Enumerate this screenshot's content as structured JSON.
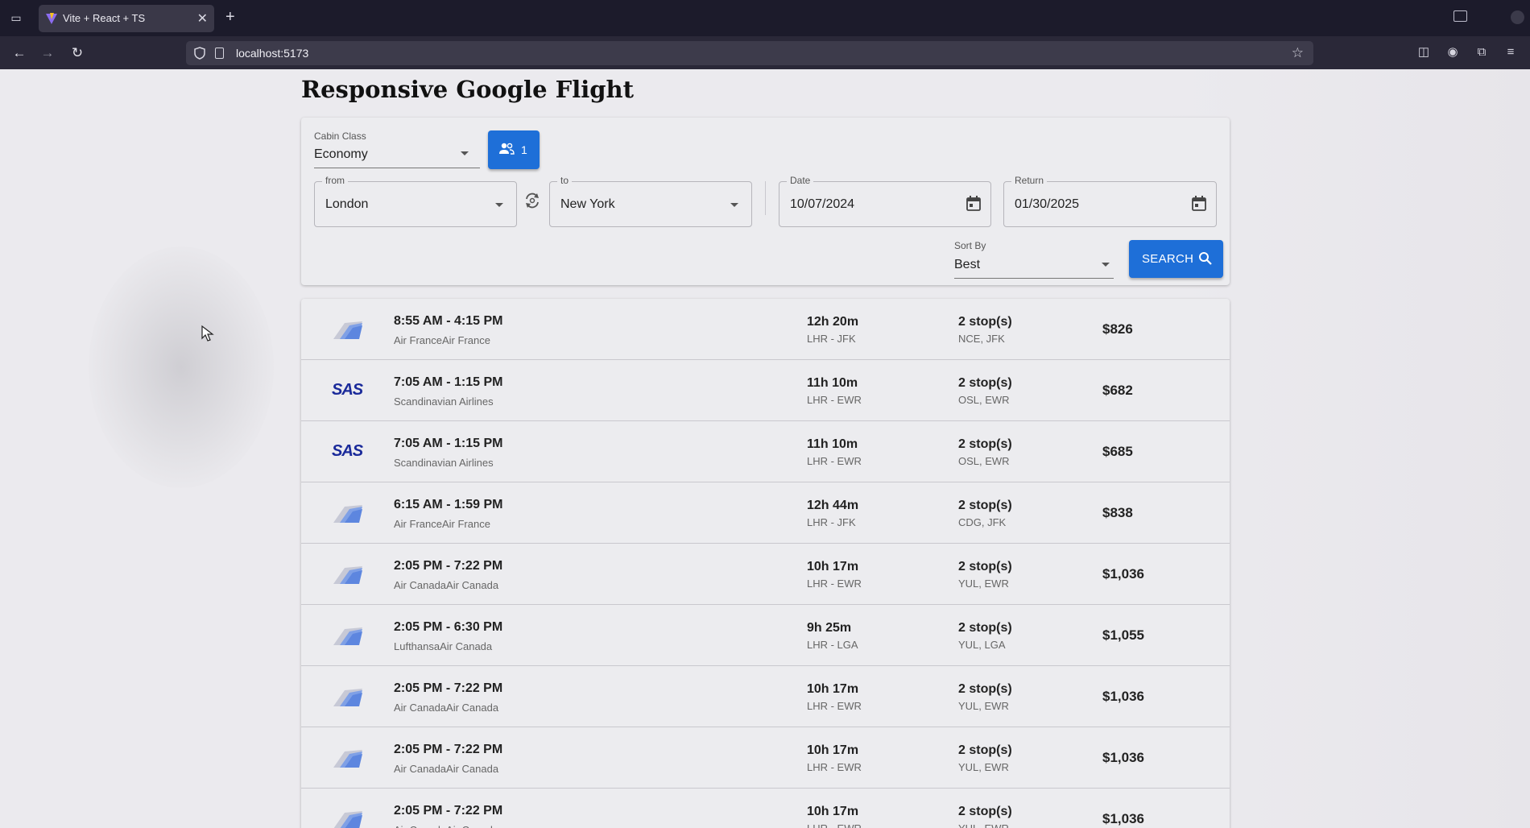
{
  "browser": {
    "tab_title": "Vite + React + TS",
    "url": "localhost:5173"
  },
  "page": {
    "title": "Responsive Google Flight"
  },
  "search": {
    "cabin_label": "Cabin Class",
    "cabin_value": "Economy",
    "passengers": "1",
    "from_label": "from",
    "from_value": "London",
    "to_label": "to",
    "to_value": "New York",
    "date_label": "Date",
    "date_value": "10/07/2024",
    "return_label": "Return",
    "return_value": "01/30/2025",
    "sort_label": "Sort By",
    "sort_value": "Best",
    "search_label": "SEARCH"
  },
  "results": [
    {
      "logo": "plane-tail-icon",
      "time": "8:55 AM - 4:15 PM",
      "airline": "Air FranceAir France",
      "duration": "12h 20m",
      "route": "LHR - JFK",
      "stops": "2 stop(s)",
      "stop_codes": "NCE, JFK",
      "price": "$826"
    },
    {
      "logo": "sas-logo",
      "logo_text": "SAS",
      "time": "7:05 AM - 1:15 PM",
      "airline": "Scandinavian Airlines",
      "duration": "11h 10m",
      "route": "LHR - EWR",
      "stops": "2 stop(s)",
      "stop_codes": "OSL, EWR",
      "price": "$682"
    },
    {
      "logo": "sas-logo",
      "logo_text": "SAS",
      "time": "7:05 AM - 1:15 PM",
      "airline": "Scandinavian Airlines",
      "duration": "11h 10m",
      "route": "LHR - EWR",
      "stops": "2 stop(s)",
      "stop_codes": "OSL, EWR",
      "price": "$685"
    },
    {
      "logo": "plane-tail-icon",
      "time": "6:15 AM - 1:59 PM",
      "airline": "Air FranceAir France",
      "duration": "12h 44m",
      "route": "LHR - JFK",
      "stops": "2 stop(s)",
      "stop_codes": "CDG, JFK",
      "price": "$838"
    },
    {
      "logo": "plane-tail-icon",
      "time": "2:05 PM - 7:22 PM",
      "airline": "Air CanadaAir Canada",
      "duration": "10h 17m",
      "route": "LHR - EWR",
      "stops": "2 stop(s)",
      "stop_codes": "YUL, EWR",
      "price": "$1,036"
    },
    {
      "logo": "plane-tail-icon",
      "time": "2:05 PM - 6:30 PM",
      "airline": "LufthansaAir Canada",
      "duration": "9h 25m",
      "route": "LHR - LGA",
      "stops": "2 stop(s)",
      "stop_codes": "YUL, LGA",
      "price": "$1,055"
    },
    {
      "logo": "plane-tail-icon",
      "time": "2:05 PM - 7:22 PM",
      "airline": "Air CanadaAir Canada",
      "duration": "10h 17m",
      "route": "LHR - EWR",
      "stops": "2 stop(s)",
      "stop_codes": "YUL, EWR",
      "price": "$1,036"
    },
    {
      "logo": "plane-tail-icon",
      "time": "2:05 PM - 7:22 PM",
      "airline": "Air CanadaAir Canada",
      "duration": "10h 17m",
      "route": "LHR - EWR",
      "stops": "2 stop(s)",
      "stop_codes": "YUL, EWR",
      "price": "$1,036"
    },
    {
      "logo": "plane-tail-icon",
      "time": "2:05 PM - 7:22 PM",
      "airline": "Air CanadaAir Canada",
      "duration": "10h 17m",
      "route": "LHR - EWR",
      "stops": "2 stop(s)",
      "stop_codes": "YUL, EWR",
      "price": "$1,036"
    }
  ],
  "colors": {
    "accent": "#1e6fd8",
    "page_bg": "#ebeaee",
    "browser_bg": "#1c1b2b"
  }
}
